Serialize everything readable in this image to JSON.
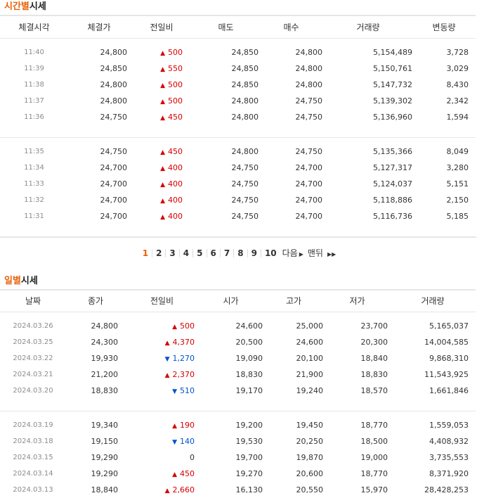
{
  "time_section": {
    "title_accent": "시간별",
    "title_rest": "시세",
    "headers": [
      "체결시각",
      "체결가",
      "전일비",
      "매도",
      "매수",
      "거래량",
      "변동량"
    ],
    "groups": [
      [
        {
          "time": "11:40",
          "price": "24,800",
          "dir": "up",
          "chg": "500",
          "sell": "24,850",
          "buy": "24,800",
          "vol": "5,154,489",
          "delta": "3,728"
        },
        {
          "time": "11:39",
          "price": "24,850",
          "dir": "up",
          "chg": "550",
          "sell": "24,850",
          "buy": "24,800",
          "vol": "5,150,761",
          "delta": "3,029"
        },
        {
          "time": "11:38",
          "price": "24,800",
          "dir": "up",
          "chg": "500",
          "sell": "24,850",
          "buy": "24,800",
          "vol": "5,147,732",
          "delta": "8,430"
        },
        {
          "time": "11:37",
          "price": "24,800",
          "dir": "up",
          "chg": "500",
          "sell": "24,800",
          "buy": "24,750",
          "vol": "5,139,302",
          "delta": "2,342"
        },
        {
          "time": "11:36",
          "price": "24,750",
          "dir": "up",
          "chg": "450",
          "sell": "24,800",
          "buy": "24,750",
          "vol": "5,136,960",
          "delta": "1,594"
        }
      ],
      [
        {
          "time": "11:35",
          "price": "24,750",
          "dir": "up",
          "chg": "450",
          "sell": "24,800",
          "buy": "24,750",
          "vol": "5,135,366",
          "delta": "8,049"
        },
        {
          "time": "11:34",
          "price": "24,700",
          "dir": "up",
          "chg": "400",
          "sell": "24,750",
          "buy": "24,700",
          "vol": "5,127,317",
          "delta": "3,280"
        },
        {
          "time": "11:33",
          "price": "24,700",
          "dir": "up",
          "chg": "400",
          "sell": "24,750",
          "buy": "24,700",
          "vol": "5,124,037",
          "delta": "5,151"
        },
        {
          "time": "11:32",
          "price": "24,700",
          "dir": "up",
          "chg": "400",
          "sell": "24,750",
          "buy": "24,700",
          "vol": "5,118,886",
          "delta": "2,150"
        },
        {
          "time": "11:31",
          "price": "24,700",
          "dir": "up",
          "chg": "400",
          "sell": "24,750",
          "buy": "24,700",
          "vol": "5,116,736",
          "delta": "5,185"
        }
      ]
    ]
  },
  "pagination": {
    "pages": [
      "1",
      "2",
      "3",
      "4",
      "5",
      "6",
      "7",
      "8",
      "9",
      "10"
    ],
    "current": "1",
    "next_label": "다음",
    "last_label": "맨뒤"
  },
  "daily_section": {
    "title_accent": "일별",
    "title_rest": "시세",
    "headers": [
      "날짜",
      "종가",
      "전일비",
      "시가",
      "고가",
      "저가",
      "거래량"
    ],
    "groups": [
      [
        {
          "date": "2024.03.26",
          "close": "24,800",
          "dir": "up",
          "chg": "500",
          "open": "24,600",
          "high": "25,000",
          "low": "23,700",
          "vol": "5,165,037"
        },
        {
          "date": "2024.03.25",
          "close": "24,300",
          "dir": "up",
          "chg": "4,370",
          "open": "20,500",
          "high": "24,600",
          "low": "20,300",
          "vol": "14,004,585"
        },
        {
          "date": "2024.03.22",
          "close": "19,930",
          "dir": "down",
          "chg": "1,270",
          "open": "19,090",
          "high": "20,100",
          "low": "18,840",
          "vol": "9,868,310"
        },
        {
          "date": "2024.03.21",
          "close": "21,200",
          "dir": "up",
          "chg": "2,370",
          "open": "18,830",
          "high": "21,900",
          "low": "18,830",
          "vol": "11,543,925"
        },
        {
          "date": "2024.03.20",
          "close": "18,830",
          "dir": "down",
          "chg": "510",
          "open": "19,170",
          "high": "19,240",
          "low": "18,570",
          "vol": "1,661,846"
        }
      ],
      [
        {
          "date": "2024.03.19",
          "close": "19,340",
          "dir": "up",
          "chg": "190",
          "open": "19,200",
          "high": "19,450",
          "low": "18,770",
          "vol": "1,559,053"
        },
        {
          "date": "2024.03.18",
          "close": "19,150",
          "dir": "down",
          "chg": "140",
          "open": "19,530",
          "high": "20,250",
          "low": "18,500",
          "vol": "4,408,932"
        },
        {
          "date": "2024.03.15",
          "close": "19,290",
          "dir": "flat",
          "chg": "0",
          "open": "19,700",
          "high": "19,870",
          "low": "19,000",
          "vol": "3,735,553"
        },
        {
          "date": "2024.03.14",
          "close": "19,290",
          "dir": "up",
          "chg": "450",
          "open": "19,270",
          "high": "20,600",
          "low": "18,770",
          "vol": "8,371,920"
        },
        {
          "date": "2024.03.13",
          "close": "18,840",
          "dir": "up",
          "chg": "2,660",
          "open": "16,130",
          "high": "20,550",
          "low": "15,970",
          "vol": "28,428,253"
        }
      ]
    ]
  },
  "colors": {
    "accent": "#e8620a",
    "up": "#d60000",
    "down": "#0052cc"
  },
  "icons": {
    "up": "triangle-up-icon",
    "down": "triangle-down-icon",
    "next": "chevron-right-icon",
    "last": "double-chevron-right-icon"
  }
}
